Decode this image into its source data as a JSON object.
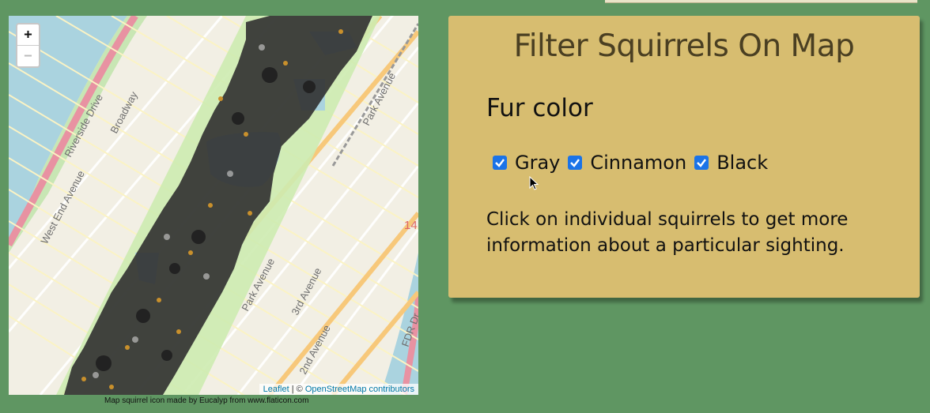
{
  "map": {
    "zoom_in_label": "+",
    "zoom_out_label": "−",
    "attribution_link_1": "Leaflet",
    "attribution_sep": " | © ",
    "attribution_link_2": "OpenStreetMap contributors",
    "icon_credit": "Map squirrel icon made by Eucalyp from www.flaticon.com",
    "street_labels": [
      "Riverside Drive",
      "Broadway",
      "West End Avenue",
      "Park Avenue",
      "3rd Avenue",
      "2nd Avenue",
      "FDR Dr",
      "Park Avenue",
      "14"
    ],
    "marker_icon": "squirrel-marker-icon"
  },
  "panel": {
    "title": "Filter Squirrels On Map",
    "fur_heading": "Fur color",
    "options": [
      {
        "label": "Gray",
        "checked": true
      },
      {
        "label": "Cinnamon",
        "checked": true
      },
      {
        "label": "Black",
        "checked": true
      }
    ],
    "help_text": "Click on individual squirrels to get more information about a particular sighting."
  },
  "colors": {
    "page_background": "#5f9662",
    "panel_background": "#d7bd70",
    "checkbox_accent": "#1a73e8",
    "title_text": "#4a3f22"
  }
}
